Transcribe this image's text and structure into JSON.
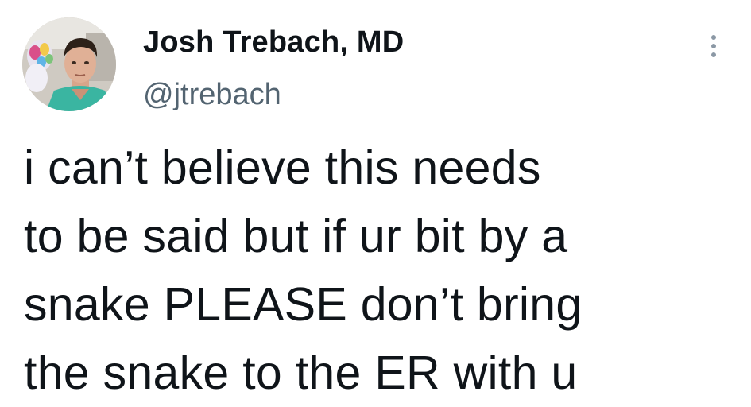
{
  "author": {
    "display_name": "Josh Trebach, MD",
    "handle": "@jtrebach",
    "avatar_icon": "profile-photo-icon"
  },
  "actions": {
    "more_icon": "more-options-icon"
  },
  "tweet": {
    "lines": [
      "i can’t believe this needs",
      "to be said but if ur bit by a",
      "snake PLEASE don’t bring",
      "the snake to the ER with u"
    ]
  },
  "colors": {
    "text_primary": "#0f1419",
    "text_secondary": "#536471",
    "background": "#ffffff"
  }
}
